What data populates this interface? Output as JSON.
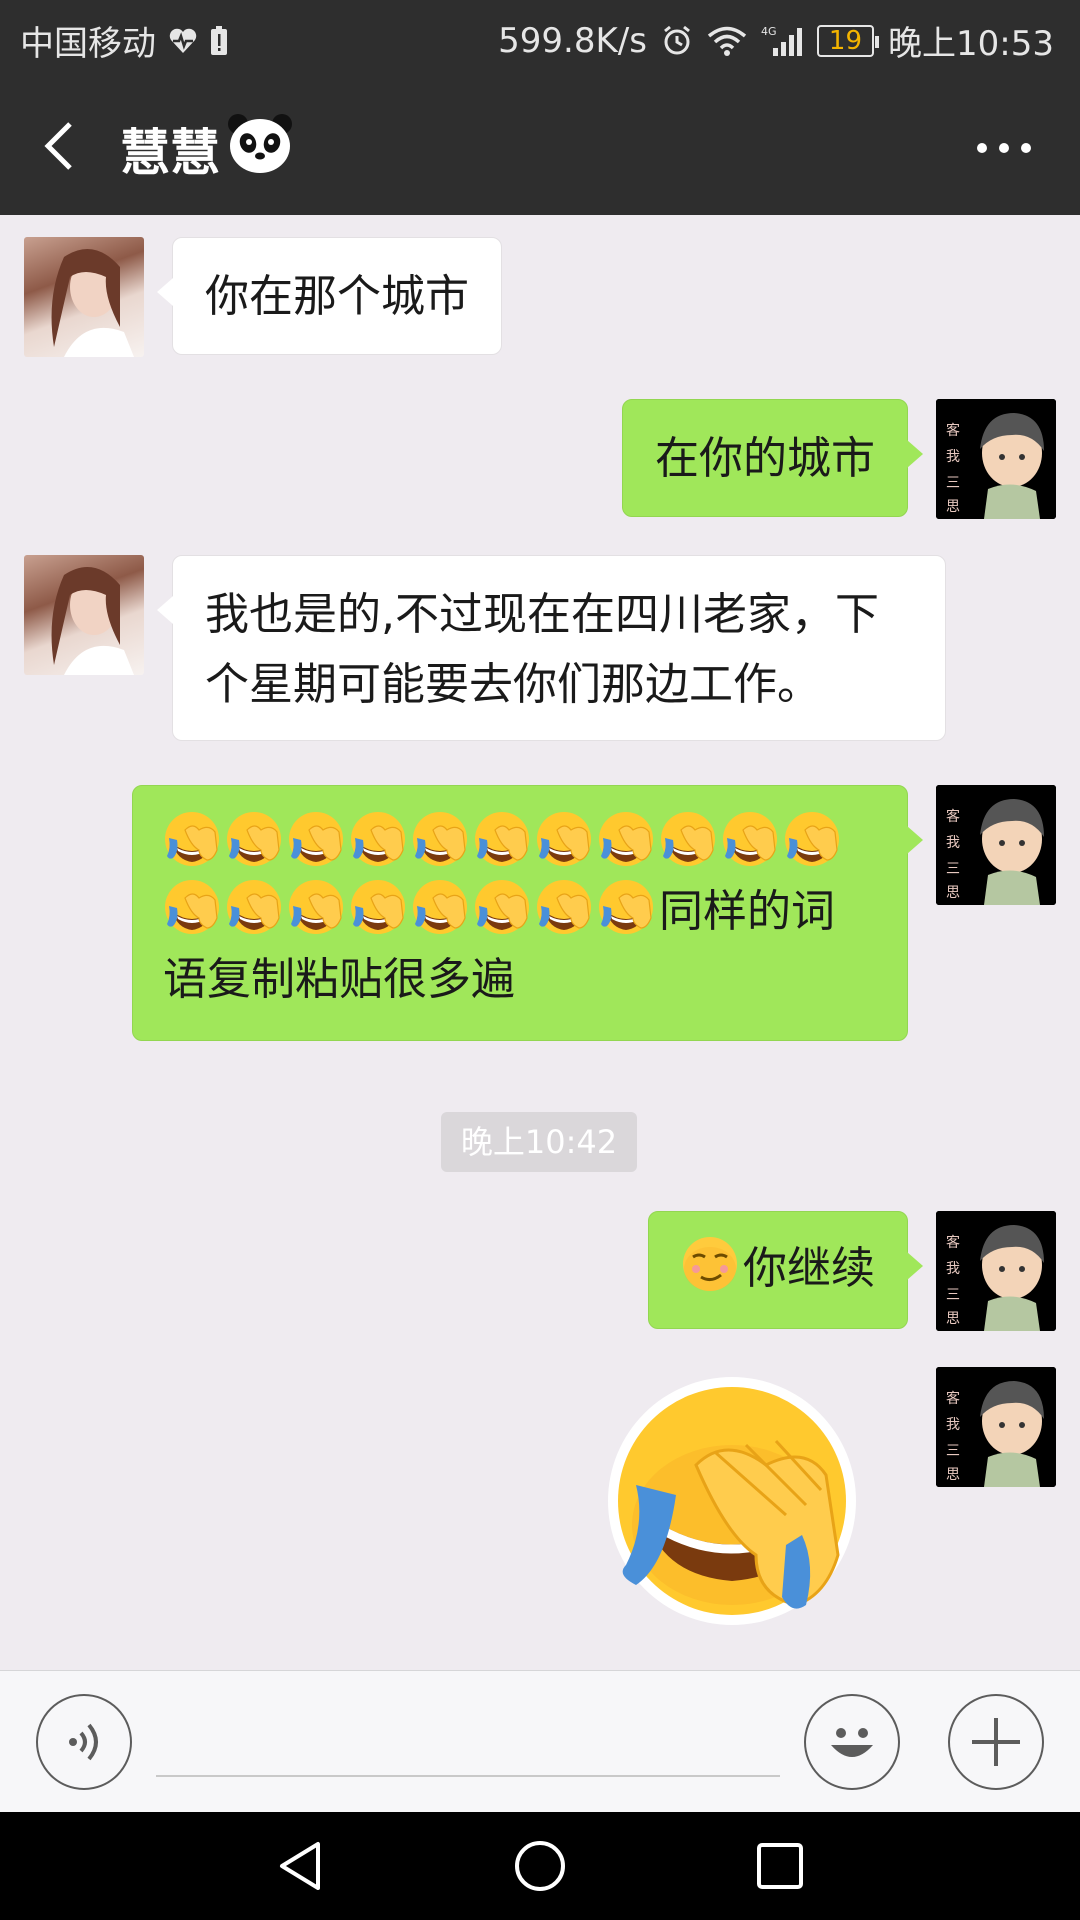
{
  "status_bar": {
    "carrier": "中国移动",
    "speed": "599.8K/s",
    "network": "4G",
    "battery": "19",
    "time": "晚上10:53"
  },
  "header": {
    "title": "慧慧",
    "title_emoji": "🐼",
    "back_icon": "chevron-left-icon",
    "more_icon": "more-dots-icon"
  },
  "messages": [
    {
      "direction": "in",
      "text": "你在那个城市"
    },
    {
      "direction": "out",
      "text": "在你的城市"
    },
    {
      "direction": "in",
      "text": "我也是的,不过现在在四川老家，下个星期可能要去你们那边工作。"
    },
    {
      "direction": "out",
      "emoji_count": 19,
      "emoji": "facepalm-laugh-icon",
      "text": "同样的词语复制粘贴很多遍"
    },
    {
      "direction": "out",
      "emoji": "smirk-icon",
      "text": "你继续"
    },
    {
      "direction": "out",
      "sticker": "facepalm-sticker"
    }
  ],
  "timestamp": "晚上10:42",
  "input_bar": {
    "voice_icon": "voice-icon",
    "placeholder": "",
    "emoji_icon": "smiley-icon",
    "plus_icon": "plus-icon"
  },
  "nav_bar": {
    "back": "nav-back-icon",
    "home": "nav-home-icon",
    "recent": "nav-recent-icon"
  },
  "colors": {
    "header_bg": "#2E2E2E",
    "chat_bg": "#EFEBF0",
    "out_bubble": "#A0E75A",
    "in_bubble": "#FFFFFF"
  }
}
